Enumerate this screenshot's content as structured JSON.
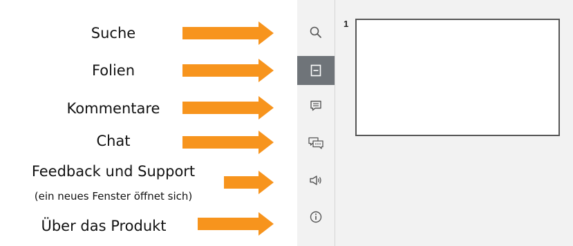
{
  "labels": {
    "search": "Suche",
    "slides": "Folien",
    "comments": "Kommentare",
    "chat": "Chat",
    "feedback": "Feedback und Support",
    "feedback_note": "(ein neues Fenster öffnet sich)",
    "about": "Über das Produkt"
  },
  "slides": {
    "first_number": "1"
  },
  "colors": {
    "arrow": "#f7941d",
    "panel_bg": "#f2f2f2",
    "active_tab": "#6f7479",
    "icon": "#555555"
  },
  "icons": {
    "search": "search-icon",
    "slides": "slides-icon",
    "comments": "comment-icon",
    "chat": "chat-icon",
    "feedback": "megaphone-icon",
    "about": "info-icon"
  }
}
